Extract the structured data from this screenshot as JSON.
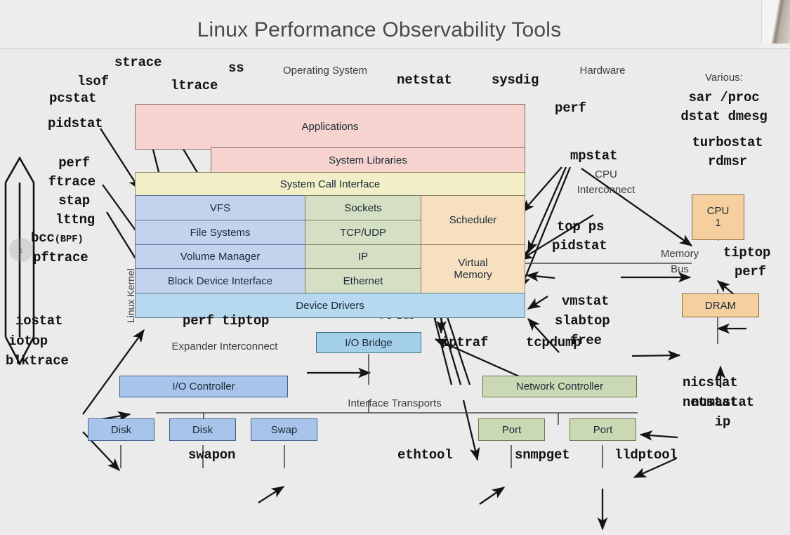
{
  "header": {
    "title": "Linux Performance Observability Tools",
    "camera_icon": "presenter-camera"
  },
  "nav": {
    "prev_icon": "chevron-left-icon",
    "prev_label": "‹"
  },
  "section_labels": {
    "operating_system": "Operating System",
    "hardware": "Hardware",
    "various": "Various:",
    "linux_kernel": "Linux Kernel",
    "cpu_interconnect_line1": "CPU",
    "cpu_interconnect_line2": "Interconnect",
    "memory_bus_line1": "Memory",
    "memory_bus_line2": "Bus",
    "io_bus": "I/O Bus",
    "expander_interconnect": "Expander Interconnect",
    "interface_transports": "Interface Transports"
  },
  "stack": {
    "applications": "Applications",
    "system_libraries": "System Libraries",
    "system_call_interface": "System Call Interface",
    "device_drivers": "Device Drivers",
    "storage_column": [
      "VFS",
      "File Systems",
      "Volume Manager",
      "Block Device Interface"
    ],
    "network_column": [
      "Sockets",
      "TCP/UDP",
      "IP",
      "Ethernet"
    ],
    "cpu_column": [
      "Scheduler",
      "Virtual Memory"
    ]
  },
  "hardware": {
    "cpu_line1": "CPU",
    "cpu_line2": "1",
    "dram": "DRAM",
    "io_bridge": "I/O Bridge",
    "io_controller": "I/O Controller",
    "network_controller": "Network Controller",
    "disk1": "Disk",
    "disk2": "Disk",
    "swap": "Swap",
    "port1": "Port",
    "port2": "Port"
  },
  "tools": {
    "strace": "strace",
    "ss": "ss",
    "lsof": "lsof",
    "pcstat": "pcstat",
    "ltrace": "ltrace",
    "pidstat_top": "pidstat",
    "netstat_top": "netstat",
    "sysdig": "sysdig",
    "perf_hw": "perf",
    "mpstat": "mpstat",
    "sar_proc": "sar /proc",
    "dstat_dmesg": "dstat dmesg",
    "turbostat": "turbostat",
    "rdmsr": "rdmsr",
    "perf_left": "perf",
    "ftrace": "ftrace",
    "stap": "stap",
    "lttng": "lttng",
    "bcc": "bcc",
    "bcc_suffix": "(BPF)",
    "pftrace": "pftrace",
    "top_ps": "top ps",
    "pidstat_right": "pidstat",
    "tiptop_right": "tiptop",
    "perf_right": "perf",
    "vmstat": "vmstat",
    "slabtop": "slabtop",
    "free": "free",
    "numastat": "numastat",
    "iostat": "iostat",
    "iotop": "iotop",
    "blktrace": "blktrace",
    "perf_tiptop": "perf tiptop",
    "iptraf": "iptraf",
    "tcpdump": "tcpdump",
    "swapon": "swapon",
    "ethtool": "ethtool",
    "snmpget": "snmpget",
    "lldptool": "lldptool",
    "nicstat": "nicstat",
    "netstat_right": "netstat",
    "ip": "ip"
  }
}
